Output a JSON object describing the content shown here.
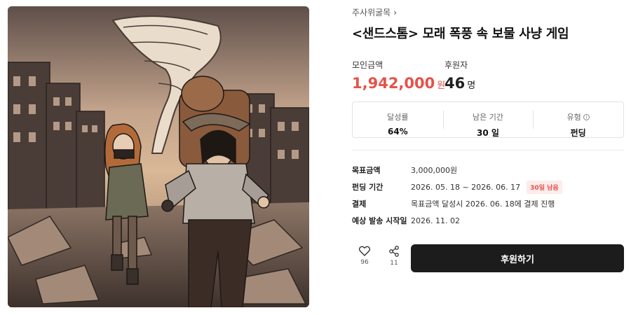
{
  "breadcrumb": {
    "label": "주사위굴목"
  },
  "project": {
    "title": "<샌드스톰> 모래 폭풍 속 보물 사냥 게임"
  },
  "stats": {
    "raised_label": "모인금액",
    "raised_value": "1,942,000",
    "raised_unit": "원",
    "backers_label": "후원자",
    "backers_value": "46",
    "backers_unit": "명"
  },
  "summary": [
    {
      "label": "달성률",
      "value": "64%"
    },
    {
      "label": "남은 기간",
      "value": "30 일"
    },
    {
      "label": "유형",
      "value": "펀딩"
    }
  ],
  "details": {
    "goal_label": "목표금액",
    "goal_value": "3,000,000원",
    "period_label": "펀딩 기간",
    "period_value": "2026. 05. 18 ~ 2026. 06. 17",
    "period_tag": "30일 남음",
    "payment_label": "결제",
    "payment_value": "목표금액 달성시 2026. 06. 18에 결제 진행",
    "ship_label": "예상 발송 시작일",
    "ship_value": "2026. 11. 02"
  },
  "actions": {
    "like_count": "96",
    "share_count": "11",
    "cta_label": "후원하기"
  },
  "icons": [
    "chevron-right-icon",
    "info-icon",
    "heart-icon",
    "share-icon"
  ],
  "colors": {
    "accent": "#e5524a",
    "cta": "#1c1c1c"
  }
}
